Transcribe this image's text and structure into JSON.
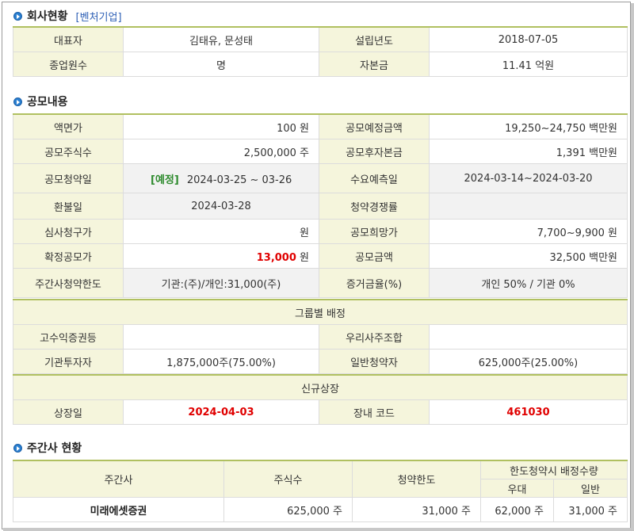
{
  "company": {
    "title": "회사현황",
    "tag": "[벤처기업]",
    "rows": [
      {
        "l1": "대표자",
        "v1": "김태유, 문성태",
        "l2": "설립년도",
        "v2": "2018-07-05"
      },
      {
        "l1": "종업원수",
        "v1": "명",
        "l2": "자본금",
        "v2": "11.41 억원"
      }
    ]
  },
  "offering": {
    "title": "공모내용",
    "face_value_label": "액면가",
    "face_value": "100 원",
    "planned_amount_label": "공모예정금액",
    "planned_amount": "19,250~24,750 백만원",
    "shares_label": "공모주식수",
    "shares": "2,500,000 주",
    "post_capital_label": "공모후자본금",
    "post_capital": "1,391 백만원",
    "sub_date_label": "공모청약일",
    "sub_date_tag": "[예정]",
    "sub_date": "2024-03-25 ~ 03-26",
    "demand_label": "수요예측일",
    "demand": "2024-03-14~2024-03-20",
    "refund_label": "환불일",
    "refund": "2024-03-28",
    "competition_label": "청약경쟁률",
    "competition": "",
    "review_price_label": "심사청구가",
    "review_price": "원",
    "hope_price_label": "공모희망가",
    "hope_price": "7,700~9,900 원",
    "final_price_label": "확정공모가",
    "final_price": "13,000",
    "final_price_unit": " 원",
    "amount_label": "공모금액",
    "amount": "32,500 백만원",
    "limit_label": "주간사청약한도",
    "limit": "기관:(주)/개인:31,000(주)",
    "margin_label": "증거금율(%)",
    "margin": "개인 50% / 기관 0%"
  },
  "group": {
    "title": "그룹별 배정",
    "high_yield_label": "고수익증권등",
    "high_yield": "",
    "esop_label": "우리사주조합",
    "esop": "",
    "inst_label": "기관투자자",
    "inst": "1,875,000주(75.00%)",
    "retail_label": "일반청약자",
    "retail": "625,000주(25.00%)"
  },
  "listing": {
    "title": "신규상장",
    "date_label": "상장일",
    "date": "2024-04-03",
    "code_label": "장내 코드",
    "code": "461030"
  },
  "underwriters": {
    "title": "주간사 현황",
    "headers": {
      "name": "주간사",
      "shares": "주식수",
      "limit": "청약한도",
      "alloc": "한도청약시 배정수량",
      "pref": "우대",
      "general": "일반"
    },
    "rows": [
      {
        "name": "미래에셋증권",
        "shares": "625,000 주",
        "limit": "31,000 주",
        "pref": "62,000 주",
        "general": "31,000 주"
      }
    ]
  },
  "colors": {
    "accent": "#2a7fd0",
    "label_bg": "#f5f5dc",
    "highlight": "#e00000",
    "tag_green": "#2e8b2e"
  }
}
